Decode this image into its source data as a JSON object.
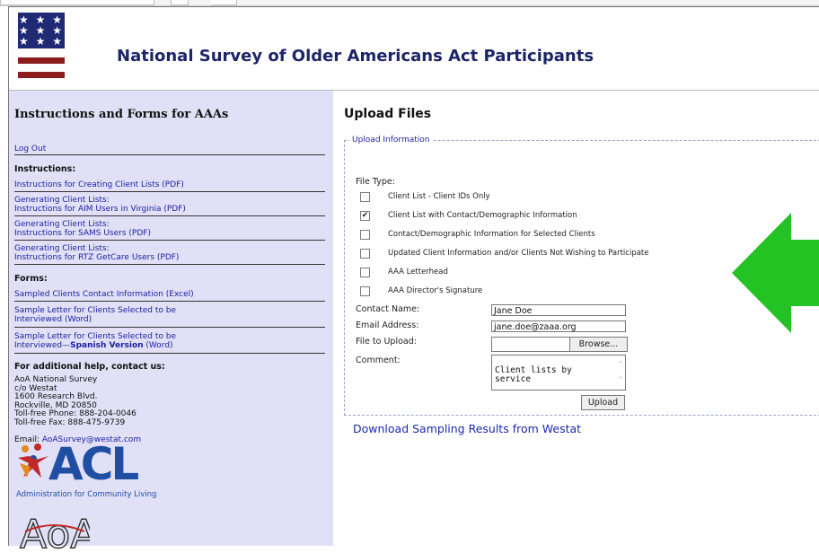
{
  "app": {
    "title": "National Survey of Older Americans Act Participants",
    "logo_stars": "★ ★ ★ ★ ★ ★ ★ ★ ★"
  },
  "sidebar": {
    "heading": "Instructions and Forms for AAAs",
    "logout": "Log Out",
    "instructions_heading": "Instructions:",
    "instruction_links": [
      "Instructions for Creating Client Lists (PDF)",
      "Generating Client Lists:",
      "Instructions for AIM Users in Virginia (PDF)",
      "Generating Client Lists:",
      "Instructions for SAMS Users (PDF)",
      "Generating Client Lists:",
      "Instructions for RTZ GetCare Users (PDF)"
    ],
    "forms_heading": "Forms:",
    "form_links": {
      "contact_excel": "Sampled Clients Contact Information (Excel)",
      "letter_word_line1": "Sample Letter for Clients Selected to be",
      "letter_word_line2": "Interviewed (Word)",
      "spanish_line1": "Sample Letter for Clients Selected to be",
      "spanish_line2_prefix": "Interviewed—",
      "spanish_bold": "Spanish Version",
      "spanish_suffix": " (Word)"
    },
    "help_heading": "For additional help, contact us:",
    "contact_text": "AoA National Survey\nc/o Westat\n1600 Research Blvd.\nRockville, MD 20850\nToll-free Phone: 888-204-0046\nToll-free Fax: 888-475-9739",
    "email_label": "Email: ",
    "email": "AoASurvey@westat.com",
    "acl_logo_text": "ACL",
    "acl_subtitle": "Administration for Community Living",
    "aoa_logo_text": "AoA"
  },
  "main": {
    "heading": "Upload Files",
    "legend": "Upload Information",
    "file_type_label": "File Type:",
    "file_types": [
      {
        "label": "Client List - Client IDs Only",
        "checked": false
      },
      {
        "label": "Client List with Contact/Demographic Information",
        "checked": true
      },
      {
        "label": "Contact/Demographic Information for Selected Clients",
        "checked": false
      },
      {
        "label": "Updated Client Information and/or Clients Not Wishing to Participate",
        "checked": false
      },
      {
        "label": "AAA Letterhead",
        "checked": false
      },
      {
        "label": "AAA Director's Signature",
        "checked": false
      }
    ],
    "check_mark": "✔",
    "contact_name_label": "Contact Name:",
    "contact_name_value": "Jane Doe",
    "email_label": "Email Address:",
    "email_value": "jane.doe@zaaa.org",
    "file_label": "File to Upload:",
    "browse_label": "Browse...",
    "comment_label": "Comment:",
    "comment_value": "Client lists by\nservice",
    "upload_label": "Upload",
    "download_link": "Download Sampling Results from Westat"
  },
  "colors": {
    "title": "#1d2468",
    "sidebar_bg": "#e2e0f6",
    "link": "#1a1ea0",
    "arrow": "#22c322"
  }
}
